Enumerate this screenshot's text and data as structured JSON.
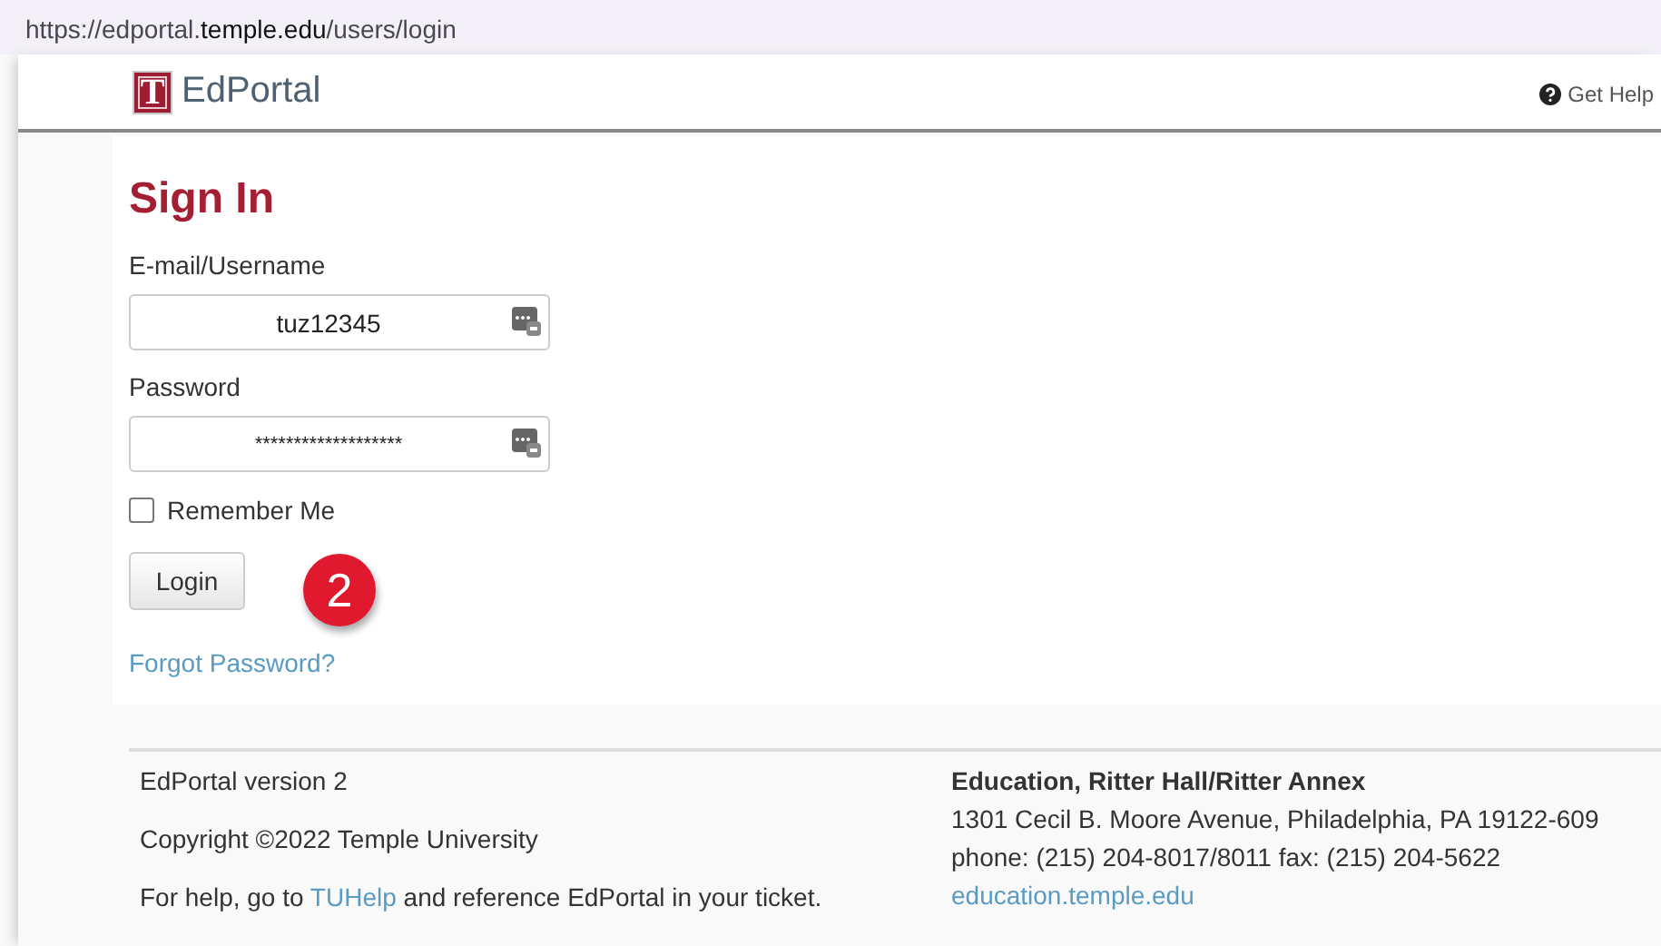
{
  "address_bar": {
    "url": "https://edportal.**temple.edu**/users/login"
  },
  "header": {
    "logo_letter": "T",
    "brand": "EdPortal",
    "help_link": "Get Help"
  },
  "form": {
    "title": "Sign In",
    "fields": [
      {
        "label": "E-mail/Username",
        "value": "tuz12345",
        "kind": "text"
      },
      {
        "label": "Password",
        "value": "*******************",
        "kind": "password"
      }
    ],
    "remember": {
      "label": "Remember Me",
      "checked": false
    },
    "button": "Login",
    "annotation": "2",
    "forgot_link": "Forgot Password?"
  },
  "footer": {
    "version": "EdPortal version 2",
    "copyright": "Copyright ©2022 Temple University",
    "help": {
      "before": "For help, go to ",
      "link": "TUHelp",
      "after": " and reference EdPortal in your ticket."
    },
    "office": "Education, Ritter Hall/Ritter Annex",
    "address": "1301 Cecil B. Moore Avenue, Philadelphia, PA 19122-609",
    "phone": "phone: (215) 204-8017/8011 fax: (215) 204-5622",
    "website": "education.temple.edu"
  }
}
